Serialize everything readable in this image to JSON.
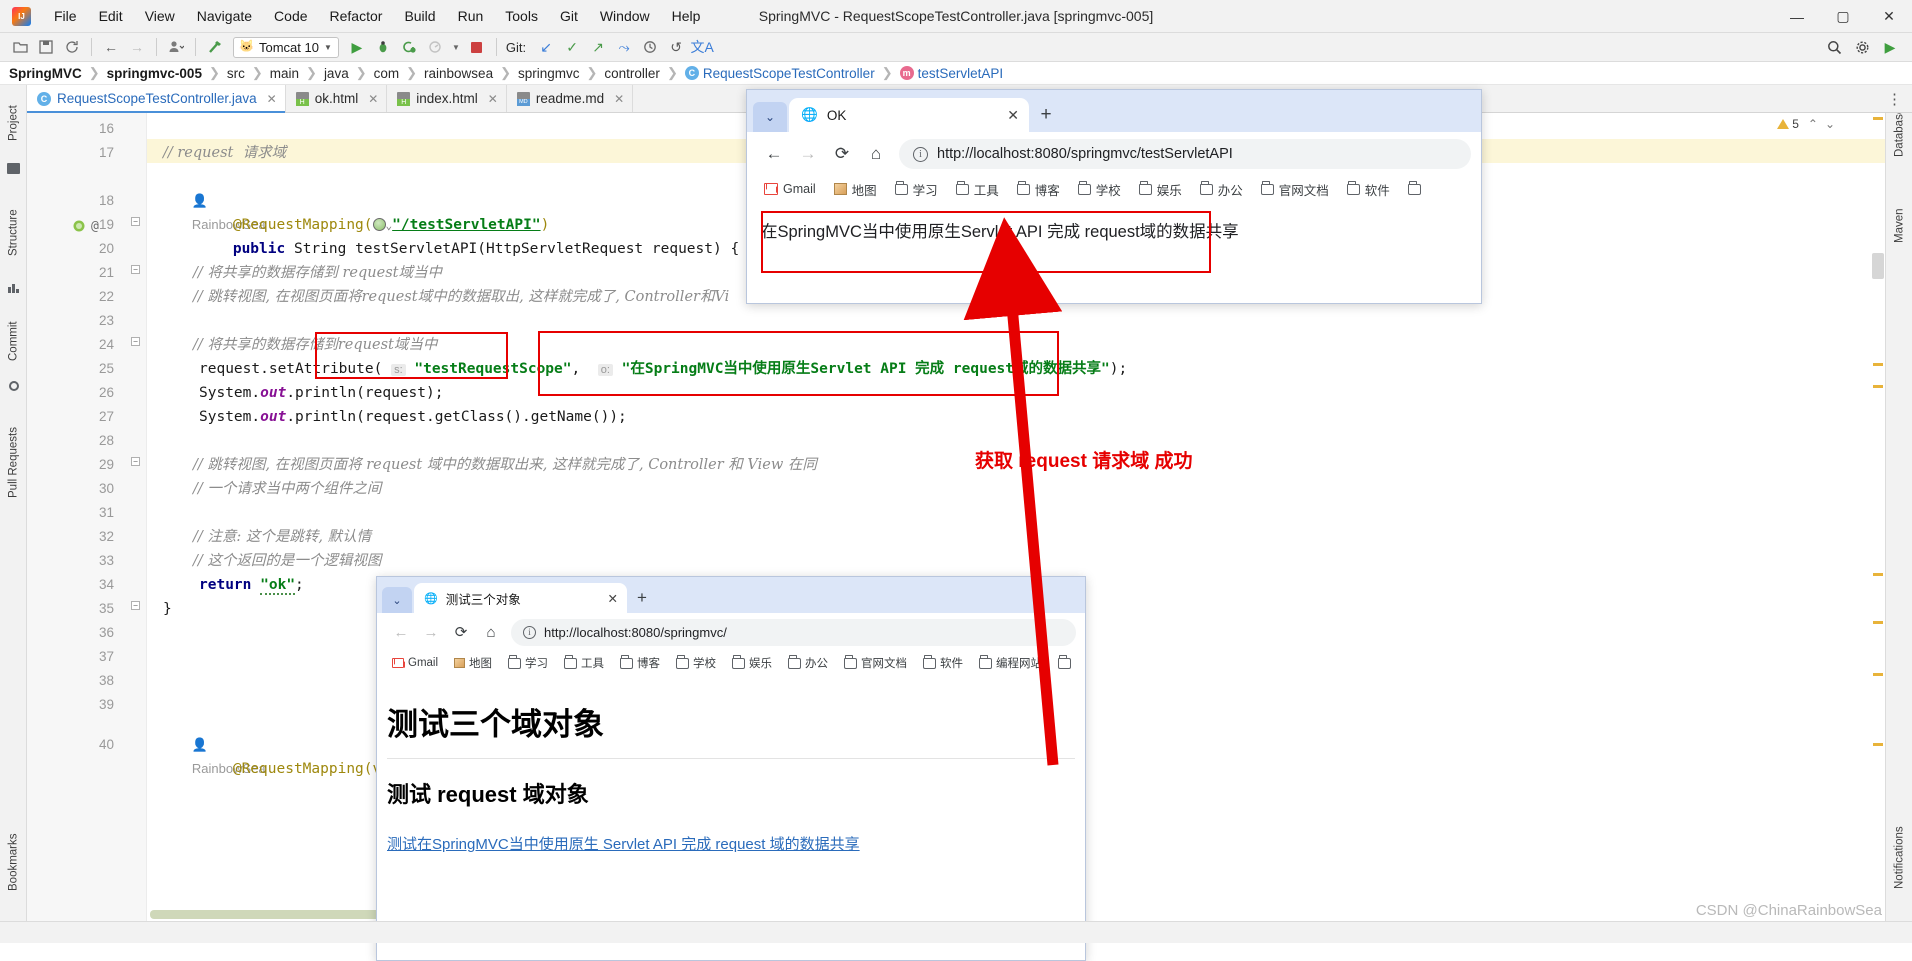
{
  "window": {
    "title": "SpringMVC - RequestScopeTestController.java [springmvc-005]",
    "minimize": "—",
    "maximize": "▢",
    "close": "✕"
  },
  "menu": [
    "File",
    "Edit",
    "View",
    "Navigate",
    "Code",
    "Refactor",
    "Build",
    "Run",
    "Tools",
    "Git",
    "Window",
    "Help"
  ],
  "toolbar": {
    "run_config": "Tomcat 10",
    "git_label": "Git:",
    "icons": [
      "open-folder-icon",
      "save-icon",
      "sync-icon",
      "back-arrow-icon",
      "forward-arrow-icon",
      "user-icon",
      "build-hammer-icon",
      "run-icon",
      "debug-icon",
      "run-coverage-icon",
      "profile-icon",
      "stop-icon",
      "git-update-icon",
      "git-commit-icon",
      "git-push-icon",
      "git-rollback-icon",
      "history-icon",
      "undo-icon",
      "translate-icon"
    ],
    "right_icons": [
      "search-icon",
      "settings-gear-icon",
      "run-green-icon"
    ]
  },
  "breadcrumb": [
    {
      "label": "SpringMVC",
      "bold": true
    },
    {
      "label": "springmvc-005",
      "bold": true
    },
    {
      "label": "src"
    },
    {
      "label": "main"
    },
    {
      "label": "java"
    },
    {
      "label": "com"
    },
    {
      "label": "rainbowsea"
    },
    {
      "label": "springmvc"
    },
    {
      "label": "controller"
    },
    {
      "label": "RequestScopeTestController",
      "icon": "c"
    },
    {
      "label": "testServletAPI",
      "icon": "m"
    }
  ],
  "tabs": [
    {
      "label": "RequestScopeTestController.java",
      "icon": "java-class-icon",
      "active": true
    },
    {
      "label": "ok.html",
      "icon": "html-file-icon",
      "active": false
    },
    {
      "label": "index.html",
      "icon": "html-file-icon",
      "active": false
    },
    {
      "label": "readme.md",
      "icon": "markdown-file-icon",
      "active": false
    }
  ],
  "tool_strips": {
    "left": [
      "Project",
      "Structure",
      "Commit",
      "Pull Requests",
      "Bookmarks"
    ],
    "right": [
      "Database",
      "Maven",
      "Notifications"
    ]
  },
  "editor": {
    "inspection_count": "5",
    "author_annotations": [
      "RainbowSea",
      "RainbowSea"
    ],
    "lines": [
      {
        "n": "16",
        "text": ""
      },
      {
        "n": "17",
        "text": "// request  请求域",
        "type": "comment",
        "highlight": true
      },
      {
        "n": "",
        "text": "RainbowSea",
        "type": "author"
      },
      {
        "n": "18",
        "text": "@RequestMapping(\"/testServletAPI\")",
        "type": "annotation"
      },
      {
        "n": "19",
        "text": "public String testServletAPI(HttpServletRequest request) {",
        "type": "code"
      },
      {
        "n": "20",
        "text": ""
      },
      {
        "n": "21",
        "text": "// 将共享的数据存储到 request域当中",
        "type": "comment"
      },
      {
        "n": "22",
        "text": "// 跳转视图, 在视图页面将request域中的数据取出, 这样就完成了, Controller和Vi",
        "type": "comment"
      },
      {
        "n": "23",
        "text": ""
      },
      {
        "n": "24",
        "text": "// 将共享的数据存储到request域当中",
        "type": "comment"
      },
      {
        "n": "25",
        "text": "request.setAttribute( s: \"testRequestScope\",  o: \"在SpringMVC当中使用原生Servlet API 完成 request域的数据共享\");",
        "type": "code"
      },
      {
        "n": "26",
        "text": "System.out.println(request);",
        "type": "code"
      },
      {
        "n": "27",
        "text": "System.out.println(request.getClass().getName());",
        "type": "code"
      },
      {
        "n": "28",
        "text": ""
      },
      {
        "n": "29",
        "text": "// 跳转视图, 在视图页面将 request 域中的数据取出来, 这样就完成了, Controller 和 View 在同",
        "type": "comment"
      },
      {
        "n": "30",
        "text": "// 一个请求当中两个组件之间",
        "type": "comment"
      },
      {
        "n": "31",
        "text": ""
      },
      {
        "n": "32",
        "text": "// 注意: 这个是跳转, 默认情",
        "type": "comment"
      },
      {
        "n": "33",
        "text": "// 这个返回的是一个逻辑视图",
        "type": "comment"
      },
      {
        "n": "34",
        "text": "return \"ok\";",
        "type": "code"
      },
      {
        "n": "35",
        "text": "}",
        "type": "code"
      },
      {
        "n": "36",
        "text": ""
      },
      {
        "n": "37",
        "text": ""
      },
      {
        "n": "38",
        "text": ""
      },
      {
        "n": "39",
        "text": ""
      },
      {
        "n": "",
        "text": "RainbowSea",
        "type": "author"
      },
      {
        "n": "40",
        "text": "@RequestMapping(value = \"/",
        "type": "annotation"
      }
    ],
    "code_tokens": {
      "param_hint_s": "s:",
      "param_hint_o": "o:",
      "string_key": "\"testRequestScope\"",
      "string_value": "\"在SpringMVC当中使用原生Servlet API 完成 request域的数据共享\"",
      "mapping_path": "\"/testServletAPI\"",
      "return_value": "\"ok\""
    }
  },
  "browser1": {
    "tab_title": "OK",
    "tab_close": "✕",
    "new_tab": "+",
    "nav": {
      "back": "←",
      "forward": "→",
      "reload": "⟳",
      "home": "⌂"
    },
    "url": "http://localhost:8080/springmvc/testServletAPI",
    "bookmarks": [
      "Gmail",
      "地图",
      "学习",
      "工具",
      "博客",
      "学校",
      "娱乐",
      "办公",
      "官网文档",
      "软件"
    ],
    "page_text": "在SpringMVC当中使用原生Servlet API 完成 request域的数据共享"
  },
  "browser2": {
    "tab_title": "测试三个对象",
    "tab_close": "✕",
    "new_tab": "+",
    "nav": {
      "back": "←",
      "forward": "→",
      "reload": "⟳",
      "home": "⌂"
    },
    "url": "http://localhost:8080/springmvc/",
    "bookmarks": [
      "Gmail",
      "地图",
      "学习",
      "工具",
      "博客",
      "学校",
      "娱乐",
      "办公",
      "官网文档",
      "软件",
      "编程网站"
    ],
    "heading1": "测试三个域对象",
    "heading2": "测试 request 域对象",
    "link": "测试在SpringMVC当中使用原生 Servlet API 完成 request 域的数据共享"
  },
  "annotations": {
    "success_text": "获取 request 请求域 成功",
    "accent_color": "#e60000"
  },
  "watermark": "CSDN @ChinaRainbowSea"
}
